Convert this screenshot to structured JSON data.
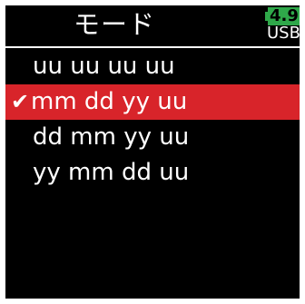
{
  "header": {
    "title": "モード",
    "battery_level": "4.9",
    "power_source": "USB"
  },
  "menu": {
    "items": [
      {
        "label": "uu uu uu uu",
        "selected": false
      },
      {
        "label": "mm dd yy uu",
        "selected": true
      },
      {
        "label": "dd mm yy uu",
        "selected": false
      },
      {
        "label": "yy mm dd uu",
        "selected": false
      }
    ],
    "check_glyph": "✔"
  },
  "colors": {
    "background": "#000000",
    "selection": "#d8242a",
    "battery": "#2fa84a",
    "text": "#ffffff"
  }
}
